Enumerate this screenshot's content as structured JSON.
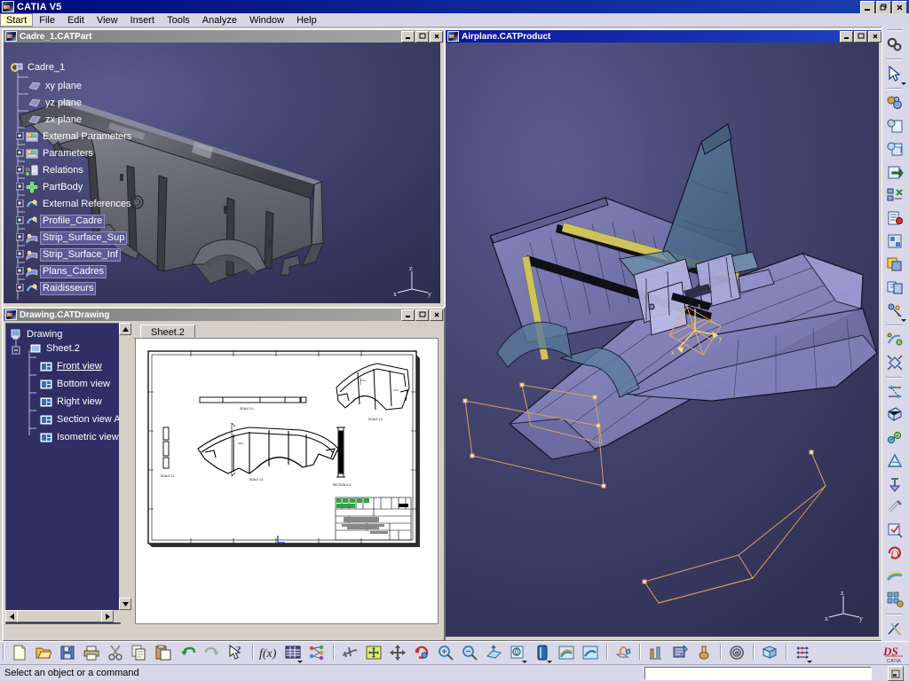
{
  "app": {
    "title": "CATIA V5",
    "icon": "catia-icon",
    "window_controls": [
      "minimize",
      "restore",
      "close"
    ]
  },
  "menubar": {
    "items": [
      {
        "label": "Start",
        "mnemonic": "S",
        "selected": true
      },
      {
        "label": "File",
        "mnemonic": "F",
        "selected": false
      },
      {
        "label": "Edit",
        "mnemonic": "E",
        "selected": false
      },
      {
        "label": "View",
        "mnemonic": "V",
        "selected": false
      },
      {
        "label": "Insert",
        "mnemonic": "I",
        "selected": false
      },
      {
        "label": "Tools",
        "mnemonic": "T",
        "selected": false
      },
      {
        "label": "Analyze",
        "mnemonic": "A",
        "selected": false
      },
      {
        "label": "Window",
        "mnemonic": "W",
        "selected": false
      },
      {
        "label": "Help",
        "mnemonic": "H",
        "selected": false
      }
    ]
  },
  "windows": {
    "part": {
      "title": "Cadre_1.CATPart",
      "active": false,
      "tree": {
        "root": "Cadre_1",
        "items": [
          {
            "label": "xy plane",
            "icon": "plane-icon",
            "depth": 1,
            "expandable": false,
            "selected": false
          },
          {
            "label": "yz plane",
            "icon": "plane-icon",
            "depth": 1,
            "expandable": false,
            "selected": false
          },
          {
            "label": "zx plane",
            "icon": "plane-icon",
            "depth": 1,
            "expandable": false,
            "selected": false
          },
          {
            "label": "External Parameters",
            "icon": "parameters-icon",
            "depth": 1,
            "expandable": true,
            "selected": false
          },
          {
            "label": "Parameters",
            "icon": "parameters-icon",
            "depth": 1,
            "expandable": true,
            "selected": false
          },
          {
            "label": "Relations",
            "icon": "relations-icon",
            "depth": 1,
            "expandable": true,
            "selected": false
          },
          {
            "label": "PartBody",
            "icon": "partbody-icon",
            "depth": 1,
            "expandable": true,
            "selected": false
          },
          {
            "label": "External References",
            "icon": "geoset-icon",
            "depth": 1,
            "expandable": true,
            "selected": false
          },
          {
            "label": "Profile_Cadre",
            "icon": "geoset-icon",
            "depth": 1,
            "expandable": true,
            "selected": true
          },
          {
            "label": "Strip_Surface_Sup",
            "icon": "surface-icon",
            "depth": 1,
            "expandable": true,
            "selected": true
          },
          {
            "label": "Strip_Surface_Inf",
            "icon": "surface-icon",
            "depth": 1,
            "expandable": true,
            "selected": true
          },
          {
            "label": "Plans_Cadres",
            "icon": "surface-icon",
            "depth": 1,
            "expandable": true,
            "selected": true
          },
          {
            "label": "Raidisseurs",
            "icon": "geoset-icon",
            "depth": 1,
            "expandable": true,
            "selected": true
          }
        ]
      },
      "axis_labels": {
        "x": "x",
        "y": "y",
        "z": "z"
      }
    },
    "product": {
      "title": "Airplane.CATProduct",
      "active": true,
      "axis_labels": {
        "x": "x",
        "y": "y",
        "z": "z"
      }
    },
    "drawing": {
      "title": "Drawing.CATDrawing",
      "active": false,
      "tree": {
        "root": "Drawing",
        "sheet": "Sheet.2",
        "views": [
          {
            "label": "Front view",
            "icon": "view-icon",
            "active": true
          },
          {
            "label": "Bottom view",
            "icon": "view-icon",
            "active": false
          },
          {
            "label": "Right view",
            "icon": "view-icon",
            "active": false
          },
          {
            "label": "Section view A-A",
            "icon": "view-icon",
            "active": false
          },
          {
            "label": "Isometric view",
            "icon": "view-icon",
            "active": false
          }
        ]
      },
      "tab_label": "Sheet.2"
    }
  },
  "bottom_toolbar": {
    "groups": [
      {
        "buttons": [
          {
            "name": "new-icon",
            "label": "New"
          },
          {
            "name": "open-icon",
            "label": "Open"
          },
          {
            "name": "save-icon",
            "label": "Save"
          },
          {
            "name": "print-icon",
            "label": "Print"
          },
          {
            "name": "cut-icon",
            "label": "Cut"
          },
          {
            "name": "copy-icon",
            "label": "Copy"
          },
          {
            "name": "paste-icon",
            "label": "Paste"
          },
          {
            "name": "undo-icon",
            "label": "Undo"
          },
          {
            "name": "redo-icon",
            "label": "Redo"
          },
          {
            "name": "whats-this-icon",
            "label": "What's This?"
          }
        ]
      },
      {
        "buttons": [
          {
            "name": "formula-icon",
            "label": "Formula"
          },
          {
            "name": "design-table-icon",
            "label": "Design Table"
          },
          {
            "name": "knowledge-icon",
            "label": "Knowledge"
          }
        ]
      },
      {
        "buttons": [
          {
            "name": "fly-mode-icon",
            "label": "Fly Mode"
          },
          {
            "name": "fit-all-in-icon",
            "label": "Fit All In"
          },
          {
            "name": "pan-icon",
            "label": "Pan"
          },
          {
            "name": "rotate-icon",
            "label": "Rotate"
          },
          {
            "name": "zoom-in-icon",
            "label": "Zoom In"
          },
          {
            "name": "zoom-out-icon",
            "label": "Zoom Out"
          },
          {
            "name": "normal-view-icon",
            "label": "Normal View"
          },
          {
            "name": "named-views-icon",
            "label": "Named Views"
          },
          {
            "name": "render-style-icon",
            "label": "Render Style"
          },
          {
            "name": "hide-show-icon",
            "label": "Hide/Show"
          },
          {
            "name": "swap-visible-space-icon",
            "label": "Swap Visible Space"
          }
        ]
      },
      {
        "buttons": [
          {
            "name": "apply-material-icon",
            "label": "Apply Material"
          }
        ]
      },
      {
        "buttons": [
          {
            "name": "measure-between-icon",
            "label": "Measure Between"
          },
          {
            "name": "measure-item-icon",
            "label": "Measure Item"
          },
          {
            "name": "measure-inertia-icon",
            "label": "Measure Inertia"
          }
        ]
      },
      {
        "buttons": [
          {
            "name": "catalog-browser-icon",
            "label": "Catalog Browser"
          }
        ]
      },
      {
        "buttons": [
          {
            "name": "help-book-icon",
            "label": "Help"
          }
        ]
      },
      {
        "buttons": [
          {
            "name": "constraints-icon",
            "label": "Constraints"
          }
        ]
      }
    ],
    "logo": "ds-catia-logo"
  },
  "right_toolbar": {
    "buttons": [
      {
        "name": "update-icon",
        "label": "Update"
      },
      {
        "name": "select-icon",
        "label": "Select"
      },
      {
        "name": "existing-component-icon",
        "label": "Existing Component"
      },
      {
        "name": "new-part-icon",
        "label": "New Part"
      },
      {
        "name": "new-product-icon",
        "label": "New Product"
      },
      {
        "name": "replace-component-icon",
        "label": "Replace Component"
      },
      {
        "name": "graph-tree-reorder-icon",
        "label": "Graph Tree Reordering"
      },
      {
        "name": "generate-numbering-icon",
        "label": "Generate Numbering"
      },
      {
        "name": "selective-load-icon",
        "label": "Selective Load"
      },
      {
        "name": "manage-representations-icon",
        "label": "Manage Representations"
      },
      {
        "name": "multi-instantiation-icon",
        "label": "Multi Instantiation"
      },
      {
        "name": "manipulation-icon",
        "label": "Manipulation"
      },
      {
        "name": "snap-icon",
        "label": "Snap"
      },
      {
        "name": "explode-icon",
        "label": "Explode"
      },
      {
        "name": "coincidence-icon",
        "label": "Coincidence Constraint"
      },
      {
        "name": "contact-icon",
        "label": "Contact Constraint"
      },
      {
        "name": "offset-icon",
        "label": "Offset Constraint"
      },
      {
        "name": "angle-icon",
        "label": "Angle Constraint"
      },
      {
        "name": "fix-component-icon",
        "label": "Fix Component"
      },
      {
        "name": "fix-together-icon",
        "label": "Fix Together"
      },
      {
        "name": "quick-constraint-icon",
        "label": "Quick Constraint"
      },
      {
        "name": "flexible-rigid-icon",
        "label": "Flexible/Rigid"
      },
      {
        "name": "change-constraint-icon",
        "label": "Change Constraint"
      },
      {
        "name": "reuse-pattern-icon",
        "label": "Reuse Pattern"
      },
      {
        "name": "scene-icon",
        "label": "Scene"
      }
    ]
  },
  "statusbar": {
    "message": "Select an object or a command",
    "command_value": "",
    "command_placeholder": ""
  },
  "colors": {
    "title_active": "#0a179c",
    "title_inactive": "#808080",
    "viewport_bg": "#43436f",
    "tree_bg": "#2f2f66",
    "selection": "#5a5a96",
    "toolbar_bg": "#d8d8e8",
    "menu_bg": "#d6d6e6",
    "sheet_bg": "#ffffff"
  }
}
